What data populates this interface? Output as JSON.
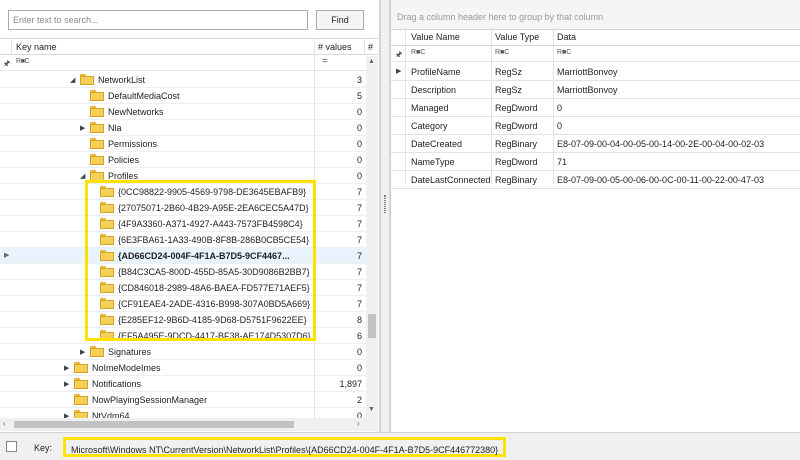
{
  "search": {
    "placeholder": "Enter text to search...",
    "find_label": "Find"
  },
  "left_grid": {
    "headers": {
      "key_name": "Key name",
      "values": "# values",
      "subkeys": "#"
    },
    "filter_values_op": "=",
    "rows": [
      {
        "name": "NetworkList",
        "count": "3",
        "expander": "open"
      },
      {
        "name": "DefaultMediaCost",
        "count": "5",
        "expander": "none"
      },
      {
        "name": "NewNetworks",
        "count": "0",
        "expander": "none"
      },
      {
        "name": "Nla",
        "count": "0",
        "expander": "closed"
      },
      {
        "name": "Permissions",
        "count": "0",
        "expander": "none"
      },
      {
        "name": "Policies",
        "count": "0",
        "expander": "none"
      },
      {
        "name": "Profiles",
        "count": "0",
        "expander": "open"
      },
      {
        "name": "{0CC98822-9905-4569-9798-DE3645EBAFB9}",
        "count": "7",
        "expander": "none"
      },
      {
        "name": "{27075071-2B60-4B29-A95E-2EA6CEC5A47D}",
        "count": "7",
        "expander": "none"
      },
      {
        "name": "{4F9A3360-A371-4927-A443-7573FB4598C4}",
        "count": "7",
        "expander": "none"
      },
      {
        "name": "{6E3FBA61-1A33-490B-8F8B-286B0CB5CE54}",
        "count": "7",
        "expander": "none"
      },
      {
        "name": "{AD66CD24-004F-4F1A-B7D5-9CF4467...",
        "count": "7",
        "expander": "none",
        "selected": true
      },
      {
        "name": "{B84C3CA5-800D-455D-85A5-30D9086B2BB7}",
        "count": "7",
        "expander": "none"
      },
      {
        "name": "{CD846018-2989-48A6-BAEA-FD577E71AEF5}",
        "count": "7",
        "expander": "none"
      },
      {
        "name": "{CF91EAE4-2ADE-4316-B998-307A0BD5A669}",
        "count": "7",
        "expander": "none"
      },
      {
        "name": "{E285EF12-9B6D-4185-9D68-D5751F9622EE}",
        "count": "8",
        "expander": "none"
      },
      {
        "name": "{EF5A495E-9DCD-4417-BF38-AE174D5307D6}",
        "count": "6",
        "expander": "none"
      },
      {
        "name": "Signatures",
        "count": "0",
        "expander": "closed"
      },
      {
        "name": "NoImeModeImes",
        "count": "0",
        "expander": "closed"
      },
      {
        "name": "Notifications",
        "count": "1,897",
        "expander": "closed"
      },
      {
        "name": "NowPlayingSessionManager",
        "count": "2",
        "expander": "none"
      },
      {
        "name": "NtVdm64",
        "count": "0",
        "expander": "closed"
      }
    ]
  },
  "right_grid": {
    "group_hint": "Drag a column header here to group by that column",
    "headers": {
      "value_name": "Value Name",
      "value_type": "Value Type",
      "data": "Data"
    },
    "rows": [
      {
        "name": "ProfileName",
        "type": "RegSz",
        "data": "MarriottBonvoy",
        "current": true
      },
      {
        "name": "Description",
        "type": "RegSz",
        "data": "MarriottBonvoy"
      },
      {
        "name": "Managed",
        "type": "RegDword",
        "data": "0"
      },
      {
        "name": "Category",
        "type": "RegDword",
        "data": "0"
      },
      {
        "name": "DateCreated",
        "type": "RegBinary",
        "data": "E8-07-09-00-04-00-05-00-14-00-2E-00-04-00-02-03"
      },
      {
        "name": "NameType",
        "type": "RegDword",
        "data": "71"
      },
      {
        "name": "DateLastConnected",
        "type": "RegBinary",
        "data": "E8-07-09-00-05-00-06-00-0C-00-11-00-22-00-47-03"
      }
    ]
  },
  "status": {
    "key_label": "Key:",
    "key_path": "Microsoft\\Windows NT\\CurrentVersion\\NetworkList\\Profiles\\{AD66CD24-004F-4F1A-B7D5-9CF446772380}"
  },
  "colors": {
    "highlight": "#ffe200",
    "folder": "#f6cf5a",
    "selected_row": "#e8f3fd"
  }
}
